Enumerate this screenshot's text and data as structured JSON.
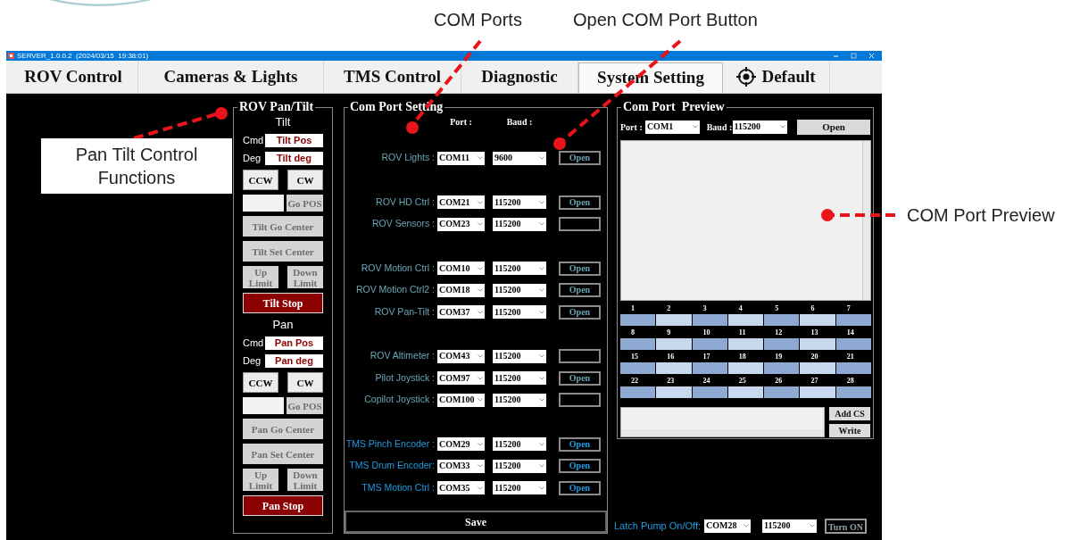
{
  "callouts": {
    "com_ports": "COM Ports",
    "open_button": "Open COM Port Button",
    "pan_tilt": "Pan Tilt Control Functions",
    "preview": "COM Port Preview"
  },
  "window": {
    "title": "SERVER_1.0.0.2  (2024/03/15  19:38:01)"
  },
  "tabs": [
    {
      "label": "ROV Control",
      "selected": false,
      "icon": false
    },
    {
      "label": "Cameras & Lights",
      "selected": false,
      "icon": false
    },
    {
      "label": "TMS Control",
      "selected": false,
      "icon": false
    },
    {
      "label": "Diagnostic",
      "selected": false,
      "icon": false
    },
    {
      "label": "System Setting",
      "selected": true,
      "icon": false
    },
    {
      "label": "Default",
      "selected": false,
      "icon": true
    }
  ],
  "pan_tilt": {
    "title": "ROV Pan/Tilt",
    "sections": [
      {
        "title": "Tilt",
        "cmd_label": "Cmd",
        "cmd_value": "Tilt Pos",
        "deg_label": "Deg",
        "deg_value": "Tilt deg",
        "rows": [
          [
            {
              "kind": "button",
              "label": "CCW",
              "disabled": false
            },
            {
              "kind": "button",
              "label": "CW",
              "disabled": false
            }
          ],
          [
            {
              "kind": "field"
            },
            {
              "kind": "button",
              "label": "Go POS",
              "disabled": true
            }
          ],
          [
            {
              "kind": "button",
              "label": "Tilt Go Center",
              "disabled": true
            }
          ],
          [
            {
              "kind": "button",
              "label": "Tilt Set Center",
              "disabled": true
            }
          ],
          [
            {
              "kind": "button",
              "label": "Up Limit",
              "disabled": true
            },
            {
              "kind": "button",
              "label": "Down Limit",
              "disabled": true
            }
          ],
          [
            {
              "kind": "stop",
              "label": "Tilt Stop"
            }
          ]
        ]
      },
      {
        "title": "Pan",
        "cmd_label": "Cmd",
        "cmd_value": "Pan Pos",
        "deg_label": "Deg",
        "deg_value": "Pan deg",
        "rows": [
          [
            {
              "kind": "button",
              "label": "CCW",
              "disabled": false
            },
            {
              "kind": "button",
              "label": "CW",
              "disabled": false
            }
          ],
          [
            {
              "kind": "field"
            },
            {
              "kind": "button",
              "label": "Go POS",
              "disabled": true
            }
          ],
          [
            {
              "kind": "button",
              "label": "Pan Go Center",
              "disabled": true
            }
          ],
          [
            {
              "kind": "button",
              "label": "Pan Set Center",
              "disabled": true
            }
          ],
          [
            {
              "kind": "button",
              "label": "Up Limit",
              "disabled": true
            },
            {
              "kind": "button",
              "label": "Down Limit",
              "disabled": true
            }
          ],
          [
            {
              "kind": "stop",
              "label": "Pan Stop"
            }
          ]
        ]
      }
    ]
  },
  "com_port_setting": {
    "title": "Com Port Setting",
    "port_header": "Port :",
    "baud_header": "Baud :",
    "groups": [
      [
        {
          "label": "ROV Lights :",
          "color": "#6aa5b5",
          "port": "COM11",
          "baud": "9600",
          "button": "Open"
        }
      ],
      [
        {
          "label": "ROV HD Ctrl :",
          "color": "#6aa5b5",
          "port": "COM21",
          "baud": "115200",
          "button": "Open"
        },
        {
          "label": "ROV Sensors :",
          "color": "#6aa5b5",
          "port": "COM23",
          "baud": "115200"
        }
      ],
      [
        {
          "label": "ROV Motion Ctrl :",
          "color": "#6aa5b5",
          "port": "COM10",
          "baud": "115200",
          "button": "Open"
        },
        {
          "label": "ROV Motion Ctrl2 :",
          "color": "#6aa5b5",
          "port": "COM18",
          "baud": "115200",
          "button": "Open"
        },
        {
          "label": "ROV Pan-Tilt :",
          "color": "#6aa5b5",
          "port": "COM37",
          "baud": "115200",
          "button": "Open"
        }
      ],
      [
        {
          "label": "ROV Altimeter :",
          "color": "#6aa5b5",
          "port": "COM43",
          "baud": "115200"
        },
        {
          "label": "Pilot Joystick :",
          "color": "#6aa5b5",
          "port": "COM97",
          "baud": "115200",
          "button": "Open"
        },
        {
          "label": "Copilot Joystick :",
          "color": "#6aa5b5",
          "port": "COM100",
          "baud": "115200"
        }
      ],
      [
        {
          "label": "TMS Pinch Encoder :",
          "color": "#1e9be0",
          "port": "COM29",
          "baud": "115200",
          "button": "Open"
        },
        {
          "label": "TMS Drum Encoder:",
          "color": "#1e9be0",
          "port": "COM33",
          "baud": "115200",
          "button": "Open"
        },
        {
          "label": "TMS Motion Ctrl :",
          "color": "#1e9be0",
          "port": "COM35",
          "baud": "115200",
          "button": "Open"
        }
      ]
    ],
    "save": "Save"
  },
  "preview": {
    "title": "Com Port  Preview",
    "port_label": "Port :",
    "port": "COM1",
    "baud_label": "Baud :",
    "baud": "115200",
    "open": "Open",
    "registers": [
      "1",
      "2",
      "3",
      "4",
      "5",
      "6",
      "7",
      "8",
      "9",
      "10",
      "11",
      "12",
      "13",
      "14",
      "15",
      "16",
      "17",
      "18",
      "19",
      "20",
      "21",
      "22",
      "23",
      "24",
      "25",
      "26",
      "27",
      "28"
    ],
    "add_cs": "Add CS",
    "write": "Write"
  },
  "latch": {
    "label": "Latch Pump On/Off:",
    "port": "COM28",
    "baud": "115200",
    "button": "Turn ON"
  }
}
